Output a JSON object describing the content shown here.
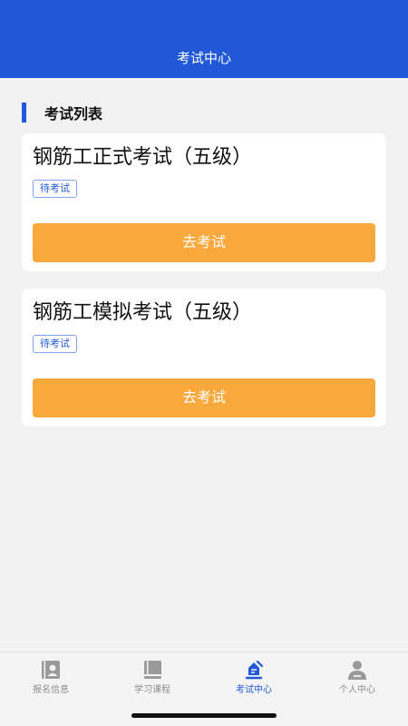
{
  "header": {
    "title": "考试中心"
  },
  "section": {
    "title": "考试列表"
  },
  "exams": [
    {
      "title": "钢筋工正式考试（五级）",
      "status": "待考试",
      "button": "去考试"
    },
    {
      "title": "钢筋工模拟考试（五级）",
      "status": "待考试",
      "button": "去考试"
    }
  ],
  "tabs": [
    {
      "label": "报名信息",
      "icon": "id-card-icon"
    },
    {
      "label": "学习课程",
      "icon": "book-icon"
    },
    {
      "label": "考试中心",
      "icon": "exam-icon"
    },
    {
      "label": "个人中心",
      "icon": "person-icon"
    }
  ],
  "colors": {
    "primary": "#2058d8",
    "button": "#f9a83c",
    "background": "#f2f2f2",
    "inactive": "#8e8e8e"
  }
}
